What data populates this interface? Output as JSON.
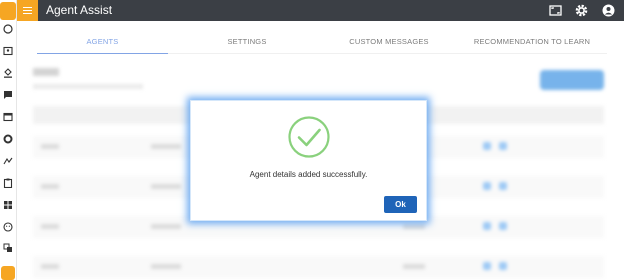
{
  "app": {
    "title": "Agent Assist",
    "accent": "#f6a623",
    "header_bg": "#3b3f45"
  },
  "header": {
    "icons": [
      "fullscreen-icon",
      "gear-icon",
      "account-icon"
    ]
  },
  "tabs": [
    {
      "label": "AGENTS",
      "active": true
    },
    {
      "label": "SETTINGS",
      "active": false
    },
    {
      "label": "CUSTOM MESSAGES",
      "active": false
    },
    {
      "label": "RECOMMENDATION TO LEARN",
      "active": false
    }
  ],
  "sidebar": {
    "icons": [
      "logo-icon",
      "palette-icon",
      "contact-card-icon",
      "paint-bucket-icon",
      "chat-icon",
      "window-icon",
      "donut-icon",
      "analytics-icon",
      "clipboard-icon",
      "apps-icon",
      "face-icon",
      "translate-icon",
      "add-icon"
    ]
  },
  "dialog": {
    "icon": "check-circle-icon",
    "message": "Agent details added successfully.",
    "ok_label": "Ok",
    "success_color": "#8ad17d",
    "button_color": "#1f64b8"
  }
}
